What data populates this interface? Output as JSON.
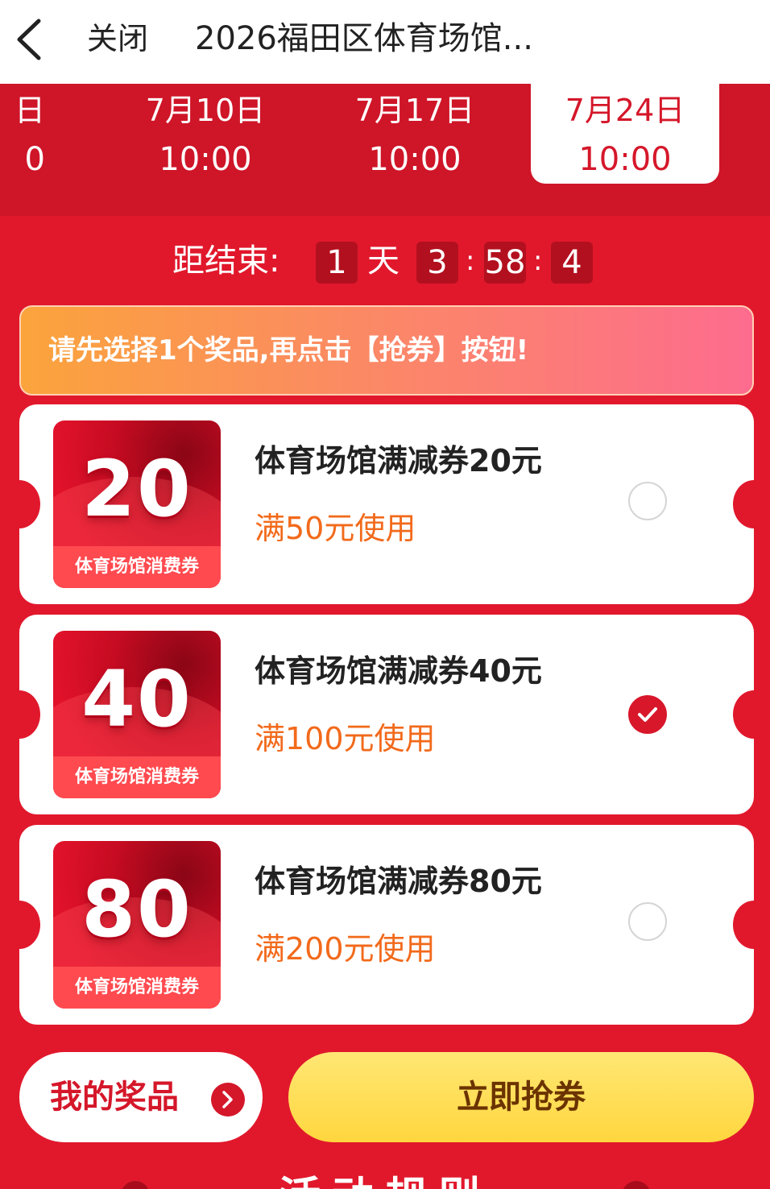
{
  "navbar": {
    "close_label": "关闭",
    "title": "2026福田区体育场馆..."
  },
  "dates": [
    {
      "date": "日",
      "time": "0",
      "partial": true
    },
    {
      "date": "7月10日",
      "time": "10:00"
    },
    {
      "date": "7月17日",
      "time": "10:00"
    },
    {
      "date": "7月24日",
      "time": "10:00",
      "active": true
    }
  ],
  "countdown": {
    "label": "距结束:",
    "days": "1",
    "day_unit": "天",
    "hours": "3",
    "minutes": "58",
    "seconds": "4",
    "sep": ":"
  },
  "tip": "请先选择1个奖品,再点击【抢券】按钮!",
  "coupons": [
    {
      "amount": "20",
      "band": "体育场馆消费券",
      "title": "体育场馆满减券20元",
      "condition": "满50元使用",
      "selected": false
    },
    {
      "amount": "40",
      "band": "体育场馆消费券",
      "title": "体育场馆满减券40元",
      "condition": "满100元使用",
      "selected": true
    },
    {
      "amount": "80",
      "band": "体育场馆消费券",
      "title": "体育场馆满减券80元",
      "condition": "满200元使用",
      "selected": false
    }
  ],
  "buttons": {
    "my_prize": "我的奖品",
    "grab": "立即抢券"
  },
  "rules_title": "活动规则",
  "colors": {
    "background_red": "#e1182c",
    "accent_red": "#d5172a",
    "condition_orange": "#f26a1b",
    "grab_button_yellow": "#ffd63e"
  }
}
